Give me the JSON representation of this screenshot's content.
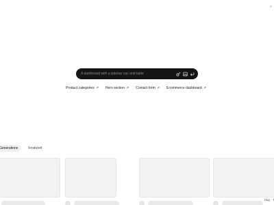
{
  "prompt": {
    "placeholder": "A dashboard with a sidebar nav and table"
  },
  "suggestions": [
    {
      "label": "Product categories",
      "arrow": "↗"
    },
    {
      "label": "Hero section",
      "arrow": "↗"
    },
    {
      "label": "Contact form",
      "arrow": "↗"
    },
    {
      "label": "Ecommerce dashboard",
      "arrow": "↗"
    }
  ],
  "tabs": [
    {
      "label": "Generations",
      "active": true
    },
    {
      "label": "Featured",
      "active": false
    }
  ],
  "footer": {
    "faq": "FAQ",
    "extra": "T"
  },
  "colors": {
    "prompt_bar": "#151515",
    "card_bg": "#f3f3f3"
  },
  "icons": {
    "prompt_actions": [
      "palette-icon",
      "image-icon",
      "submit-icon"
    ]
  }
}
